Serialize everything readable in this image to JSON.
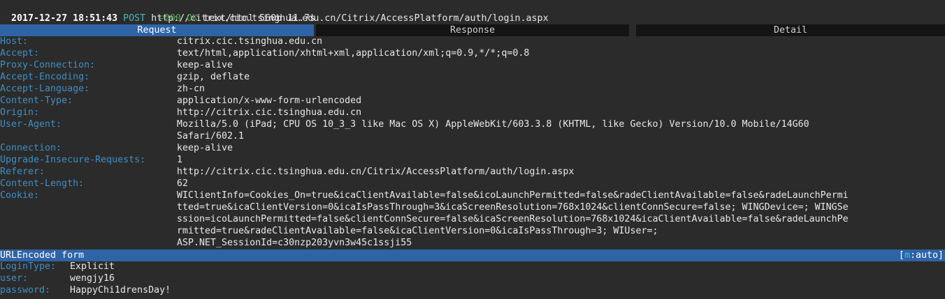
{
  "flow": {
    "timestamp": "2017-12-27 18:51:43",
    "method": "POST",
    "url": "http://citrix.cic.tsinghua.edu.cn/Citrix/AccessPlatform/auth/login.aspx",
    "response_arrow": "←",
    "status": "200 OK",
    "response_summary": "text/html 560b 11.7s"
  },
  "tabs": [
    {
      "label": "Request",
      "active": true
    },
    {
      "label": "Response",
      "active": false
    },
    {
      "label": "Detail",
      "active": false
    }
  ],
  "headers": [
    {
      "key": "Host:",
      "value": [
        "citrix.cic.tsinghua.edu.cn"
      ]
    },
    {
      "key": "Accept:",
      "value": [
        "text/html,application/xhtml+xml,application/xml;q=0.9,*/*;q=0.8"
      ]
    },
    {
      "key": "Proxy-Connection:",
      "value": [
        "keep-alive"
      ]
    },
    {
      "key": "Accept-Encoding:",
      "value": [
        "gzip, deflate"
      ]
    },
    {
      "key": "Accept-Language:",
      "value": [
        "zh-cn"
      ]
    },
    {
      "key": "Content-Type:",
      "value": [
        "application/x-www-form-urlencoded"
      ]
    },
    {
      "key": "Origin:",
      "value": [
        "http://citrix.cic.tsinghua.edu.cn"
      ]
    },
    {
      "key": "User-Agent:",
      "value": [
        "Mozilla/5.0 (iPad; CPU OS 10_3_3 like Mac OS X) AppleWebKit/603.3.8 (KHTML, like Gecko) Version/10.0 Mobile/14G60",
        "Safari/602.1"
      ]
    },
    {
      "key": "Connection:",
      "value": [
        "keep-alive"
      ]
    },
    {
      "key": "Upgrade-Insecure-Requests:",
      "value": [
        "1"
      ]
    },
    {
      "key": "Referer:",
      "value": [
        "http://citrix.cic.tsinghua.edu.cn/Citrix/AccessPlatform/auth/login.aspx"
      ]
    },
    {
      "key": "Content-Length:",
      "value": [
        "62"
      ]
    },
    {
      "key": "Cookie:",
      "value": [
        "WIClientInfo=Cookies_On=true&icaClientAvailable=false&icoLaunchPermitted=false&radeClientAvailable=false&radeLaunchPermi",
        "tted=true&icaClientVersion=0&icaIsPassThrough=3&icaScreenResolution=768x1024&clientConnSecure=false; WINGDevice=; WINGSe",
        "ssion=icoLaunchPermitted=false&clientConnSecure=false&icaScreenResolution=768x1024&icaClientAvailable=false&radeLaunchPe",
        "rmitted=true&radeClientAvailable=false&icaClientVersion=0&icaIsPassThrough=3; WIUser=;",
        "ASP.NET_SessionId=c30nzp203yvn3w45c1ssji55"
      ]
    }
  ],
  "form_section": {
    "title": "URLEncoded form",
    "mode_open": "[",
    "mode_key": "m",
    "mode_value": ":auto]"
  },
  "form_fields": [
    {
      "key": "LoginType:",
      "value": "Explicit"
    },
    {
      "key": "user:",
      "value": "wengjy16"
    },
    {
      "key": "password:",
      "value": "HappyChi1drensDay!"
    }
  ],
  "colors": {
    "background": "#2b2b2b",
    "accent_bar": "#2e64a6",
    "header_key": "#3f8fc4",
    "status_green": "#4ea24e",
    "method": "#4fb3b8"
  }
}
